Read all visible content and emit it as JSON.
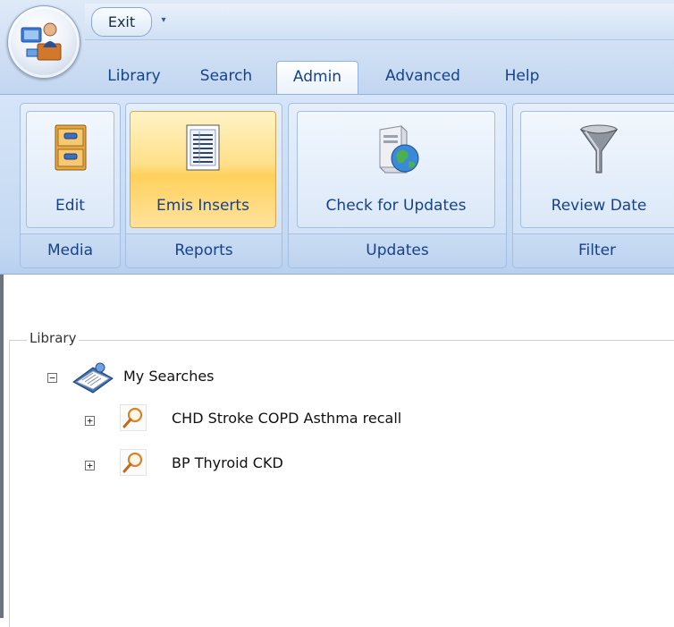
{
  "app": {
    "menu_icon": "app-menu-icon",
    "exit_label": "Exit"
  },
  "tabs": [
    {
      "label": "Library",
      "active": false
    },
    {
      "label": "Search",
      "active": false
    },
    {
      "label": "Admin",
      "active": true
    },
    {
      "label": "Advanced",
      "active": false
    },
    {
      "label": "Help",
      "active": false
    }
  ],
  "ribbon": {
    "groups": [
      {
        "label": "Media",
        "buttons": [
          {
            "label": "Edit",
            "icon": "cabinet-icon"
          }
        ]
      },
      {
        "label": "Reports",
        "buttons": [
          {
            "label": "Emis Inserts",
            "icon": "report-icon",
            "pressed": true
          }
        ]
      },
      {
        "label": "Updates",
        "buttons": [
          {
            "label": "Check for Updates",
            "icon": "server-globe-icon"
          }
        ]
      },
      {
        "label": "Filter",
        "buttons": [
          {
            "label": "Review Date",
            "icon": "funnel-icon"
          }
        ]
      }
    ]
  },
  "library": {
    "legend": "Library",
    "root": {
      "label": "My Searches",
      "icon": "searches-book-icon",
      "expanded": true
    },
    "items": [
      {
        "label": "CHD Stroke COPD Asthma recall",
        "icon": "magnifier-icon",
        "expanded": false
      },
      {
        "label": "BP Thyroid CKD",
        "icon": "magnifier-icon",
        "expanded": false
      }
    ]
  },
  "colors": {
    "ribbon_text": "#15428b",
    "pressed_button": "#ffd05c",
    "ribbon_panel": "#c3d8f2"
  }
}
